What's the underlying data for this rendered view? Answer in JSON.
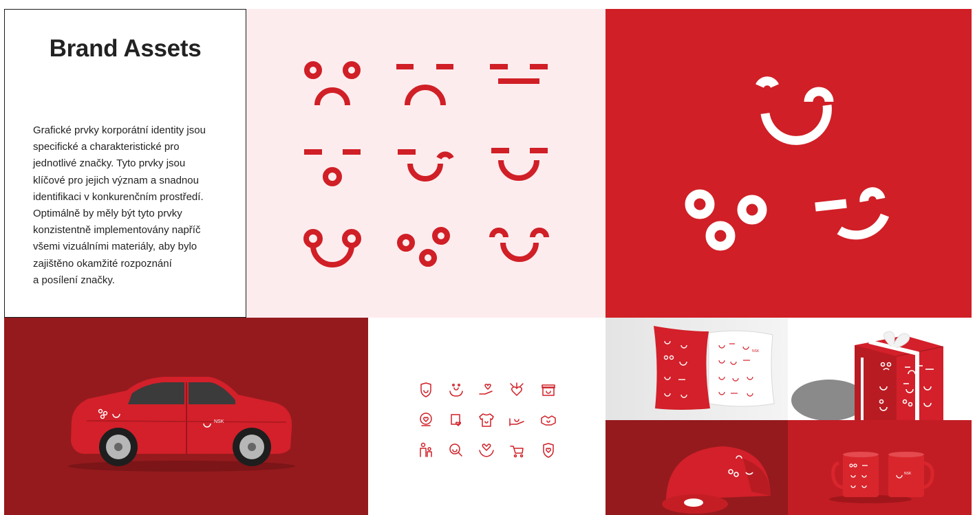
{
  "page": {
    "title": "Brand Assets",
    "description": "Grafické prvky korporátní identity jsou\nspecifické a charakteristické pro\njednotlivé značky. Tyto prvky jsou\nklíčové pro jejich význam a snadnou\nidentifikaci v konkurenčním prostředí.\nOptimálně by měly být tyto prvky\nkonzistentně implementovány napříč\nvšemi vizuálními materiály, aby bylo\nzajištěno okamžité rozpoznání\na posílení značky."
  },
  "brand": {
    "wordmark": "NSK",
    "colors": {
      "primary": "#d01f26",
      "dark": "#951a1d",
      "light": "#fdecee"
    }
  },
  "faces": [
    "face-sad-circles",
    "face-sad-dashes",
    "face-flat-lines",
    "face-surprised",
    "face-wink",
    "face-smile-dashes",
    "face-smile-loops",
    "face-circles-cluster",
    "face-smile-arcs"
  ],
  "icons": [
    "shield-smile-icon",
    "hands-smile-icon",
    "hand-heart-icon",
    "heart-network-icon",
    "gift-smile-icon",
    "badge-heart-icon",
    "box-heart-icon",
    "shirt-smile-icon",
    "hand-smile-icon",
    "handshake-icon",
    "family-icon",
    "search-smile-icon",
    "hands-heart-icon",
    "stroller-icon",
    "shield-heart-icon"
  ]
}
